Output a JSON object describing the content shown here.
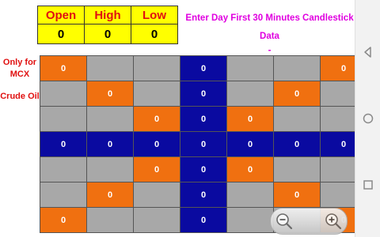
{
  "ohl": {
    "open_label": "Open",
    "high_label": "High",
    "low_label": "Low",
    "open_value": "0",
    "high_value": "0",
    "low_value": "0"
  },
  "title": {
    "line1": "Enter Day First 30 Minutes Candlestick Data",
    "line2": "-"
  },
  "side": {
    "line1": "Only for",
    "line2": "MCX",
    "line3": "Crude Oil"
  },
  "grid": {
    "rows": [
      [
        {
          "c": "o",
          "v": "0"
        },
        {
          "c": "g",
          "v": ""
        },
        {
          "c": "g",
          "v": ""
        },
        {
          "c": "b",
          "v": "0"
        },
        {
          "c": "g",
          "v": ""
        },
        {
          "c": "g",
          "v": ""
        },
        {
          "c": "o",
          "v": "0"
        }
      ],
      [
        {
          "c": "g",
          "v": ""
        },
        {
          "c": "o",
          "v": "0"
        },
        {
          "c": "g",
          "v": ""
        },
        {
          "c": "b",
          "v": "0"
        },
        {
          "c": "g",
          "v": ""
        },
        {
          "c": "o",
          "v": "0"
        },
        {
          "c": "g",
          "v": ""
        }
      ],
      [
        {
          "c": "g",
          "v": ""
        },
        {
          "c": "g",
          "v": ""
        },
        {
          "c": "o",
          "v": "0"
        },
        {
          "c": "b",
          "v": "0"
        },
        {
          "c": "o",
          "v": "0"
        },
        {
          "c": "g",
          "v": ""
        },
        {
          "c": "g",
          "v": ""
        }
      ],
      [
        {
          "c": "b",
          "v": "0"
        },
        {
          "c": "b",
          "v": "0"
        },
        {
          "c": "b",
          "v": "0"
        },
        {
          "c": "b",
          "v": "0"
        },
        {
          "c": "b",
          "v": "0"
        },
        {
          "c": "b",
          "v": "0"
        },
        {
          "c": "b",
          "v": "0"
        }
      ],
      [
        {
          "c": "g",
          "v": ""
        },
        {
          "c": "g",
          "v": ""
        },
        {
          "c": "o",
          "v": "0"
        },
        {
          "c": "b",
          "v": "0"
        },
        {
          "c": "o",
          "v": "0"
        },
        {
          "c": "g",
          "v": ""
        },
        {
          "c": "g",
          "v": ""
        }
      ],
      [
        {
          "c": "g",
          "v": ""
        },
        {
          "c": "o",
          "v": "0"
        },
        {
          "c": "g",
          "v": ""
        },
        {
          "c": "b",
          "v": "0"
        },
        {
          "c": "g",
          "v": ""
        },
        {
          "c": "o",
          "v": "0"
        },
        {
          "c": "g",
          "v": ""
        }
      ],
      [
        {
          "c": "o",
          "v": "0"
        },
        {
          "c": "g",
          "v": ""
        },
        {
          "c": "g",
          "v": ""
        },
        {
          "c": "b",
          "v": "0"
        },
        {
          "c": "g",
          "v": ""
        },
        {
          "c": "g",
          "v": ""
        },
        {
          "c": "o",
          "v": "0"
        }
      ]
    ]
  },
  "colors": {
    "orange": "#f07010",
    "gray": "#a8a8a8",
    "blue": "#0a0aa0",
    "yellow": "#ffff00",
    "title": "#e000e0",
    "red": "#e01010"
  },
  "icons": [
    "back-icon",
    "home-icon",
    "recents-icon",
    "zoom-out-icon",
    "zoom-in-icon"
  ]
}
